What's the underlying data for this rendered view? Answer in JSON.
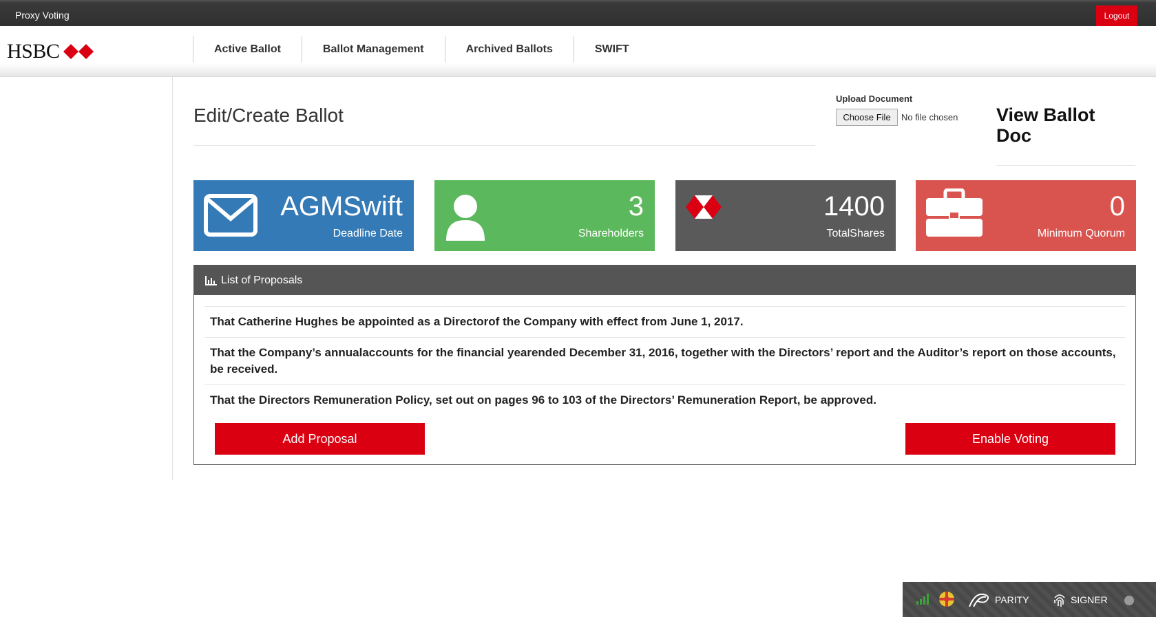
{
  "topbar": {
    "title": "Proxy Voting",
    "logout_label": "Logout"
  },
  "brand": {
    "name": "HSBC",
    "logo_icon": "hsbc-hexagon-icon",
    "accent": "#db0011"
  },
  "nav": {
    "items": [
      {
        "label": "Active Ballot"
      },
      {
        "label": "Ballot Management"
      },
      {
        "label": "Archived Ballots"
      },
      {
        "label": "SWIFT"
      }
    ]
  },
  "page": {
    "title": "Edit/Create Ballot",
    "upload_label": "Upload Document",
    "file_button_label": "Choose File",
    "file_status": "No file chosen",
    "view_doc_label": "View Ballot Doc"
  },
  "cards": [
    {
      "value": "AGMSwift",
      "label": "Deadline Date",
      "icon": "envelope-icon",
      "color": "#337ab7"
    },
    {
      "value": "3",
      "label": "Shareholders",
      "icon": "user-icon",
      "color": "#5cb85c"
    },
    {
      "value": "1400",
      "label": "TotalShares",
      "icon": "hsbc-hexagon-icon",
      "color": "#5a5a5a"
    },
    {
      "value": "0",
      "label": "Minimum Quorum",
      "icon": "briefcase-icon",
      "color": "#d9534f"
    }
  ],
  "proposals": {
    "heading": "List of Proposals",
    "heading_icon": "bar-chart-icon",
    "items": [
      {
        "text": "That Catherine Hughes be appointed as a Directorof the Company with effect from June 1, 2017."
      },
      {
        "text": "That the Company’s annualaccounts for the financial yearended December 31, 2016, together with the Directors’ report and the Auditor’s report on those accounts, be received."
      },
      {
        "text": "That the Directors Remuneration Policy, set out on pages 96 to 103 of the Directors’ Remuneration Report, be approved."
      }
    ],
    "add_label": "Add Proposal",
    "enable_label": "Enable Voting"
  },
  "extension_bar": {
    "parity_label": "PARITY",
    "signer_label": "SIGNER"
  }
}
